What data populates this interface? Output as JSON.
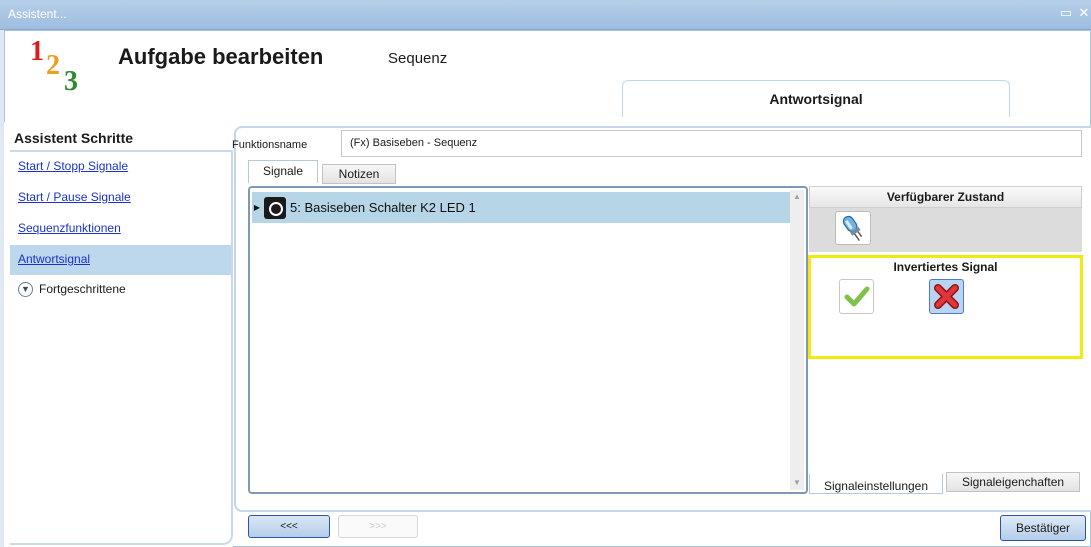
{
  "window": {
    "title": "Assistent...",
    "maximize_icon": "maximize-icon",
    "close_icon": "close-icon"
  },
  "header": {
    "logo_digits": [
      "1",
      "2",
      "3"
    ],
    "title": "Aufgabe bearbeiten",
    "subtitle": "Sequenz",
    "active_step_tab": "Antwortsignal"
  },
  "sidebar": {
    "heading": "Assistent Schritte",
    "steps": [
      {
        "label": "Start / Stopp Signale"
      },
      {
        "label": "Start / Pause Signale"
      },
      {
        "label": "Sequenzfunktionen"
      },
      {
        "label": "Antwortsignal",
        "active": true
      }
    ],
    "advanced_label": "Fortgeschrittene"
  },
  "form": {
    "function_name_label": "Funktionsname",
    "function_name_value": "(Fx) Basiseben - Sequenz",
    "tabs": [
      "Signale",
      "Notizen"
    ],
    "selected_tab": "Signale"
  },
  "signals": {
    "rows": [
      {
        "label": "5: Basiseben Schalter K2 LED 1",
        "icon": "led-icon",
        "selected": true
      }
    ]
  },
  "right_panel": {
    "available_state_header": "Verfügbarer Zustand",
    "available_state_icon": "light-bulb-icon",
    "inverted_signal_header": "Invertiertes Signal",
    "inverted_options": [
      {
        "icon": "checkmark-icon",
        "color": "#7ec24b"
      },
      {
        "icon": "red-x-icon",
        "color": "#d8232a",
        "selected": true
      }
    ],
    "bottom_tabs": [
      "Signaleinstellungen",
      "Signaleigenchaften"
    ],
    "selected_bottom_tab": "Signaleinstellungen"
  },
  "footer": {
    "back_label": "<<<",
    "next_label": ">>>",
    "confirm_label": "Bestätiger"
  },
  "colors": {
    "titlebar": "#a8c5e6",
    "selection": "#b6d5e6",
    "highlight_border": "#f2ea0b",
    "link": "#1a33cc"
  }
}
